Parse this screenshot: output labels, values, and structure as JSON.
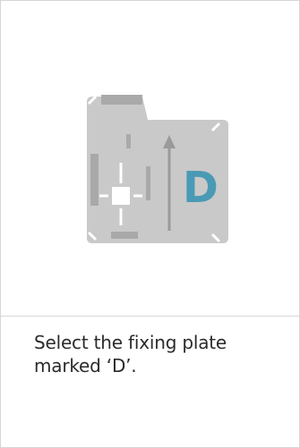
{
  "plate": {
    "letter": "D",
    "letter_color": "#4a9ab5",
    "plate_color": "#c9c9c9",
    "detail_color": "#a9a9a9",
    "cross_color": "#ffffff",
    "arrow_color": "#9a9a9a"
  },
  "instruction": {
    "text": "Select the fixing plate marked ‘D’."
  }
}
